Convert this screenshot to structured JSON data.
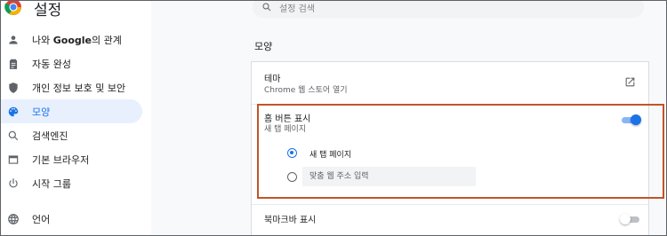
{
  "app": {
    "title": "설정",
    "logo_icon": "chrome-logo-icon"
  },
  "sidebar": {
    "items": [
      {
        "label_prefix": "나와 ",
        "label_brand": "Google",
        "label_suffix": "의 관계",
        "icon": "person-icon"
      },
      {
        "label": "자동 완성",
        "icon": "clipboard-icon"
      },
      {
        "label": "개인 정보 보호 및 보안",
        "icon": "shield-icon"
      },
      {
        "label": "모양",
        "icon": "palette-icon",
        "active": true
      },
      {
        "label": "검색엔진",
        "icon": "search-icon"
      },
      {
        "label": "기본 브라우저",
        "icon": "browser-window-icon"
      },
      {
        "label": "시작 그룹",
        "icon": "power-icon"
      },
      {
        "label": "언어",
        "icon": "globe-icon"
      }
    ]
  },
  "search": {
    "placeholder": "설정 검색"
  },
  "appearance": {
    "section_title": "모양",
    "theme": {
      "title": "테마",
      "subtitle": "Chrome 웹 스토어 열기"
    },
    "home_button": {
      "title": "홈 버튼 표시",
      "subtitle": "새 탭 페이지",
      "enabled": true,
      "options": {
        "new_tab": "새 탭 페이지",
        "custom_placeholder": "맞춤 웹 주소 입력"
      },
      "selected": "new_tab"
    },
    "bookmarks_bar": {
      "title": "북마크바 표시",
      "enabled": false
    }
  },
  "colors": {
    "accent": "#1a73e8",
    "highlight_border": "#c1542a"
  }
}
